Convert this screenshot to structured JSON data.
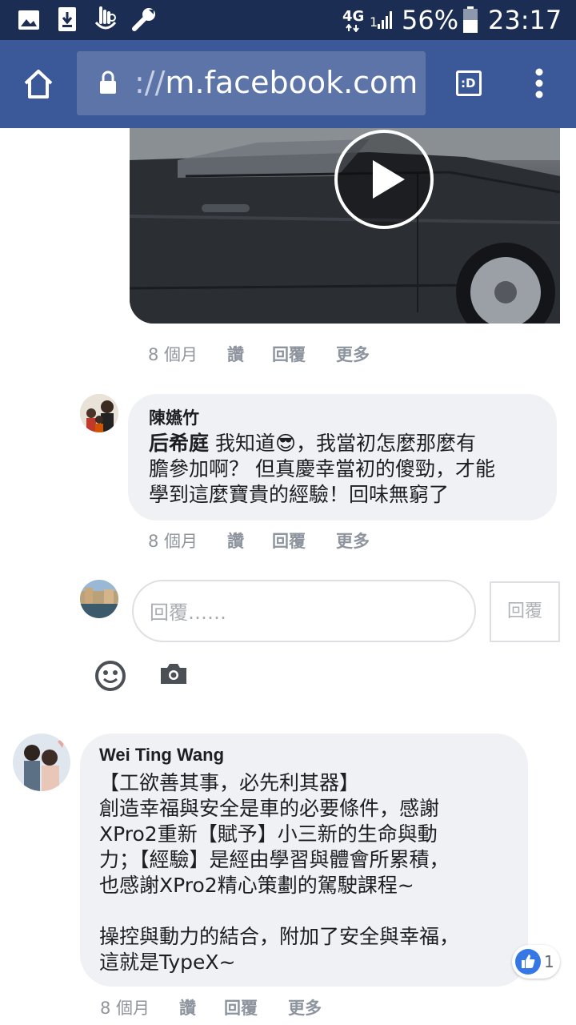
{
  "status_bar": {
    "network": "4G",
    "sim": "1",
    "battery": "56%",
    "time": "23:17"
  },
  "browser": {
    "url_scheme": "://",
    "url_host": "m.facebook.com",
    "tab_switcher_label": ":D"
  },
  "video_actions": {
    "time": "8 個月",
    "like": "讚",
    "reply": "回覆",
    "more": "更多"
  },
  "reply_comment": {
    "author": "陳嬿竹",
    "mention": "后希庭",
    "line1": "我知道😎，我當初怎麼那麼有",
    "line2": "膽參加啊？ 但真慶幸當初的傻勁，才能",
    "line3": "學到這麼寶貴的經驗！回味無窮了",
    "time": "8 個月",
    "like": "讚",
    "reply": "回覆",
    "more": "更多"
  },
  "reply_box": {
    "placeholder": "回覆……",
    "button": "回覆"
  },
  "main_comment": {
    "author": "Wei Ting Wang",
    "lines": [
      "【工欲善其事，必先利其器】",
      "創造幸福與安全是車的必要條件，感謝",
      "XPro2重新【賦予】小三新的生命與動",
      "力；【經驗】是經由學習與體會所累積，",
      "也感謝XPro2精心策劃的駕駛課程~",
      "",
      "操控與動力的結合，附加了安全與幸福，",
      "這就是TypeX~"
    ],
    "like_count": "1",
    "time": "8 個月",
    "like": "讚",
    "reply": "回覆",
    "more": "更多"
  },
  "colors": {
    "facebook_blue": "#3b5998",
    "status_bar": "#1c2d53",
    "bubble": "#f0f1f4",
    "meta_text": "#90949c"
  }
}
